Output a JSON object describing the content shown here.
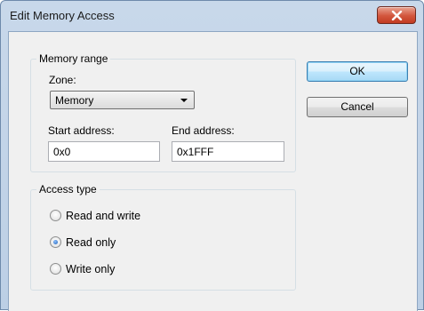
{
  "window": {
    "title": "Edit Memory Access",
    "close_icon": "close-icon"
  },
  "memory_range": {
    "legend": "Memory range",
    "zone_label": "Zone:",
    "zone_value": "Memory",
    "start_label": "Start address:",
    "start_value": "0x0",
    "end_label": "End address:",
    "end_value": "0x1FFF"
  },
  "access_type": {
    "legend": "Access type",
    "options": [
      {
        "label": "Read and write",
        "checked": false
      },
      {
        "label": "Read only",
        "checked": true
      },
      {
        "label": "Write only",
        "checked": false
      }
    ]
  },
  "buttons": {
    "ok": "OK",
    "cancel": "Cancel"
  },
  "colors": {
    "titlebar": "#c8d8ea",
    "close_button": "#c23b22",
    "default_button_border": "#3c7fb1"
  }
}
